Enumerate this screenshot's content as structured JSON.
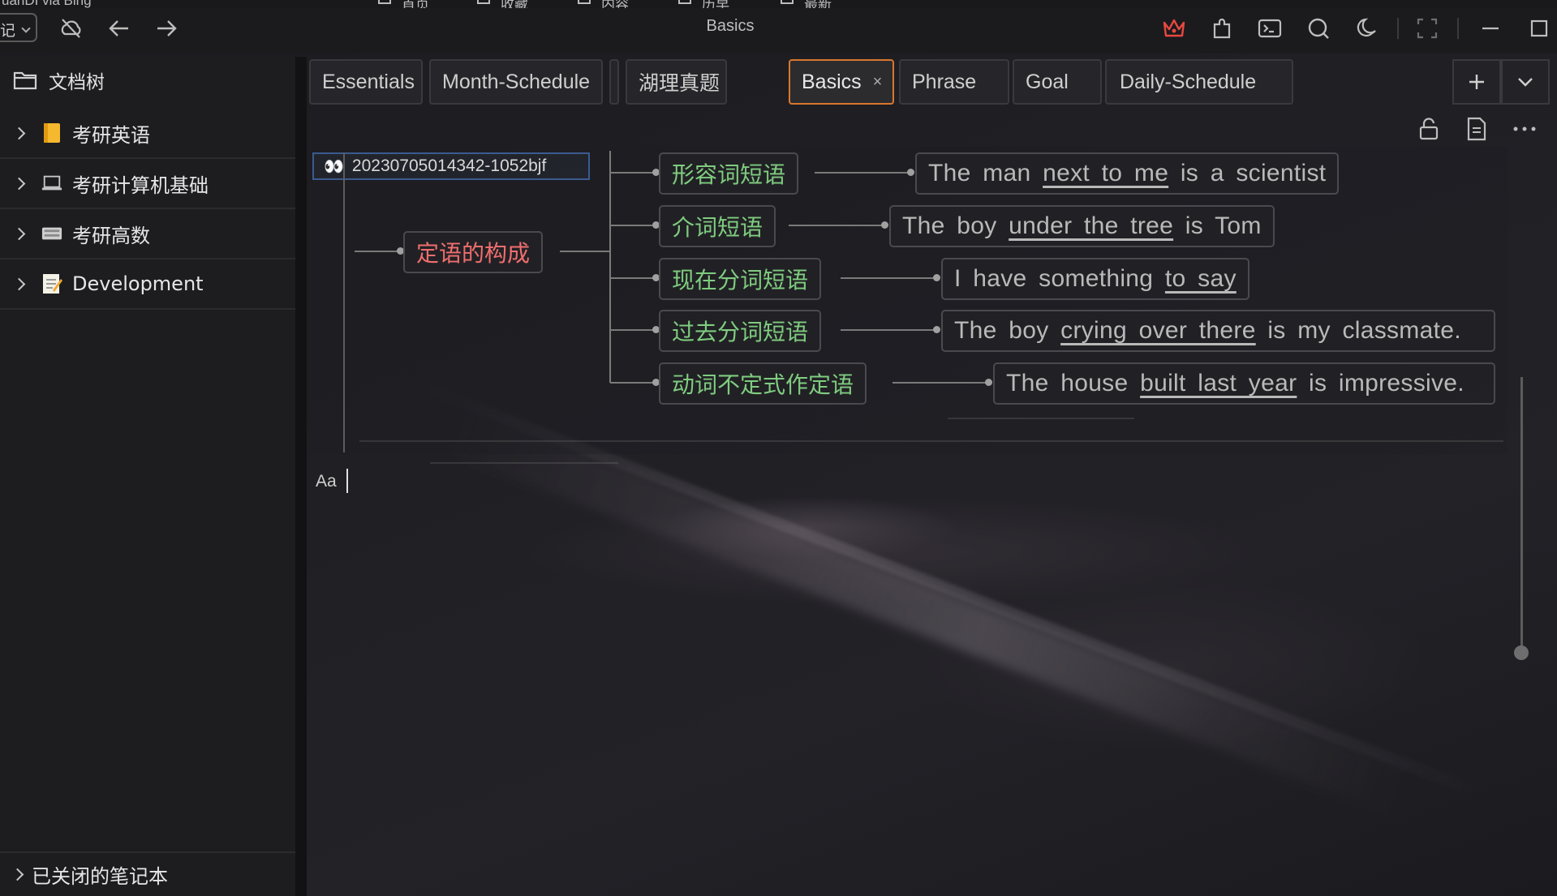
{
  "top_strip": {
    "left_text": "uanDI via Bing",
    "items": [
      "首页",
      "收藏",
      "内容",
      "历早",
      "最新"
    ]
  },
  "titlebar": {
    "notebook_select": "记",
    "title": "Basics",
    "icons": [
      "sync-off-icon",
      "back-icon",
      "forward-icon",
      "crown-icon",
      "plugin-icon",
      "terminal-icon",
      "search-icon",
      "dark-mode-icon",
      "fullscreen-icon",
      "minimize-icon",
      "maximize-icon"
    ],
    "accent": "#e8483f"
  },
  "sidebar": {
    "header": "文档树",
    "items": [
      {
        "label": "考研英语",
        "icon": "notebook-yellow-icon"
      },
      {
        "label": "考研计算机基础",
        "icon": "laptop-icon"
      },
      {
        "label": "考研高数",
        "icon": "keyboard-icon"
      },
      {
        "label": "Development",
        "icon": "memo-icon"
      }
    ],
    "closed_notebooks": "已关闭的笔记本"
  },
  "tabs": [
    {
      "label": "Essentials",
      "active": false
    },
    {
      "label": "Month-Schedule",
      "active": false
    },
    {
      "label": "湖理真题",
      "active": false
    },
    {
      "label": "Basics",
      "active": true
    },
    {
      "label": "Phrase",
      "active": false
    },
    {
      "label": "Goal",
      "active": false
    },
    {
      "label": "Daily-Schedule",
      "active": false
    }
  ],
  "tab_accent": "#d9772f",
  "editor": {
    "doc_id": "20230705014342-1052bjf",
    "mindmap": {
      "root": "定语的构成",
      "branches": [
        {
          "label": "形容词短语",
          "sentence": [
            {
              "t": "The man ",
              "u": false
            },
            {
              "t": "next to me",
              "u": true
            },
            {
              "t": " is a scientist",
              "u": false
            }
          ]
        },
        {
          "label": "介词短语",
          "sentence": [
            {
              "t": "The boy ",
              "u": false
            },
            {
              "t": "under the tree",
              "u": true
            },
            {
              "t": " is Tom",
              "u": false
            }
          ]
        },
        {
          "label": "现在分词短语",
          "sentence": [
            {
              "t": "I have something ",
              "u": false
            },
            {
              "t": "to say",
              "u": true
            }
          ]
        },
        {
          "label": "过去分词短语",
          "sentence": [
            {
              "t": "The boy ",
              "u": false
            },
            {
              "t": "crying over there",
              "u": true
            },
            {
              "t": " is my classmate.",
              "u": false
            }
          ]
        },
        {
          "label": "动词不定式作定语",
          "sentence": [
            {
              "t": "The house ",
              "u": false
            },
            {
              "t": "built last year",
              "u": true
            },
            {
              "t": " is impressive.",
              "u": false
            }
          ]
        }
      ],
      "root_color": "#f06e6e",
      "branch_color": "#7fcc7f"
    },
    "font_indicator": "Aa"
  }
}
